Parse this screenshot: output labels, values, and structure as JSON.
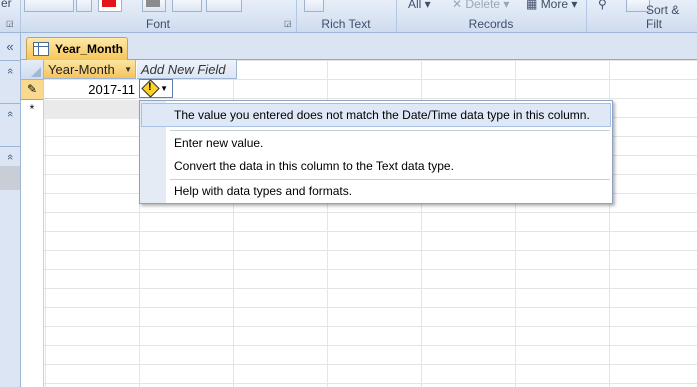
{
  "ribbon": {
    "groups": [
      {
        "name": "Font",
        "label": "Font"
      },
      {
        "name": "Rich Text",
        "label": "Rich Text"
      },
      {
        "name": "Records",
        "label": "Records"
      },
      {
        "name": "Sort & Filter",
        "label": "Sort & Filt"
      }
    ],
    "left_fragment": "er",
    "records_all": "All",
    "records_delete": "Delete",
    "records_more": "More"
  },
  "nav": {
    "collapse": "«",
    "chevrons": [
      "«",
      "«",
      "«"
    ]
  },
  "document": {
    "tab_label": "Year_Month"
  },
  "datasheet": {
    "columns": [
      {
        "label": "Year-Month"
      },
      {
        "label": "Add New Field"
      }
    ],
    "rows": [
      {
        "value": "2017-11"
      }
    ],
    "new_row_marker": "*",
    "edit_marker": "✎"
  },
  "error_menu": {
    "message": "The value you entered does not match the Date/Time data type in this column.",
    "items": [
      {
        "label": "Enter new value."
      },
      {
        "label": "Convert the data in this column to the Text data type."
      },
      {
        "label": "Help with data types and formats."
      }
    ]
  }
}
